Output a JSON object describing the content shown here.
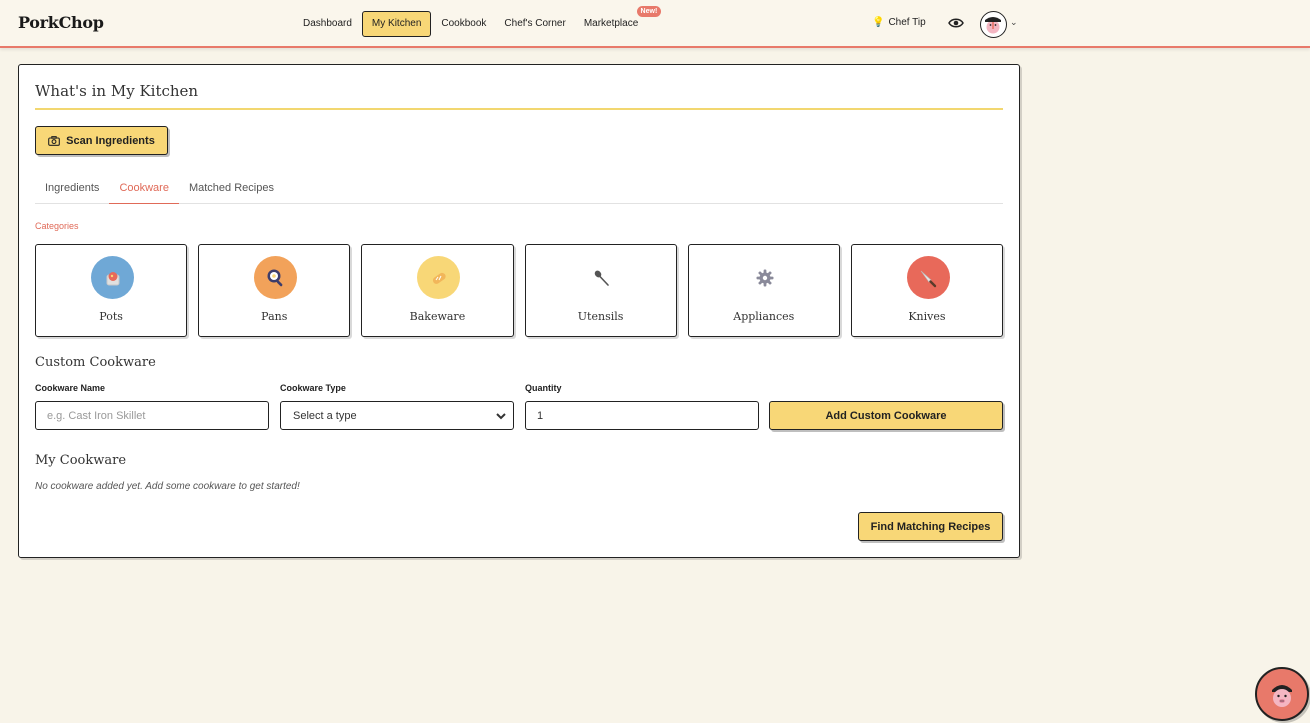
{
  "app": {
    "title": "PorkChop"
  },
  "nav": {
    "items": [
      {
        "label": "Dashboard"
      },
      {
        "label": "My Kitchen"
      },
      {
        "label": "Cookbook"
      },
      {
        "label": "Chef's Corner"
      },
      {
        "label": "Marketplace"
      }
    ],
    "new_badge": "New!"
  },
  "header": {
    "chef_tip": "Chef Tip"
  },
  "page": {
    "title": "What's in My Kitchen",
    "scan_button": "Scan Ingredients",
    "tabs": [
      {
        "label": "Ingredients"
      },
      {
        "label": "Cookware"
      },
      {
        "label": "Matched Recipes"
      }
    ],
    "active_tab": "Cookware",
    "categories_label": "Categories",
    "categories": [
      {
        "label": "Pots",
        "icon": "pot-icon",
        "color": "#6fa8d6"
      },
      {
        "label": "Pans",
        "icon": "pan-icon",
        "color": "#f2a25a"
      },
      {
        "label": "Bakeware",
        "icon": "bread-icon",
        "color": "#f8d777"
      },
      {
        "label": "Utensils",
        "icon": "spoon-icon",
        "color": "#ffffff"
      },
      {
        "label": "Appliances",
        "icon": "gear-icon",
        "color": "#ffffff"
      },
      {
        "label": "Knives",
        "icon": "knife-icon",
        "color": "#e8695a"
      }
    ],
    "custom_title": "Custom Cookware",
    "form": {
      "name_label": "Cookware Name",
      "name_placeholder": "e.g. Cast Iron Skillet",
      "type_label": "Cookware Type",
      "type_selected": "Select a type",
      "quantity_label": "Quantity",
      "quantity_value": "1",
      "add_button": "Add Custom Cookware"
    },
    "my_title": "My Cookware",
    "empty_message": "No cookware added yet. Add some cookware to get started!",
    "find_button": "Find Matching Recipes"
  },
  "colors": {
    "accent": "#f8d777",
    "brand_red": "#e8796a",
    "background": "#f8f4e9"
  }
}
